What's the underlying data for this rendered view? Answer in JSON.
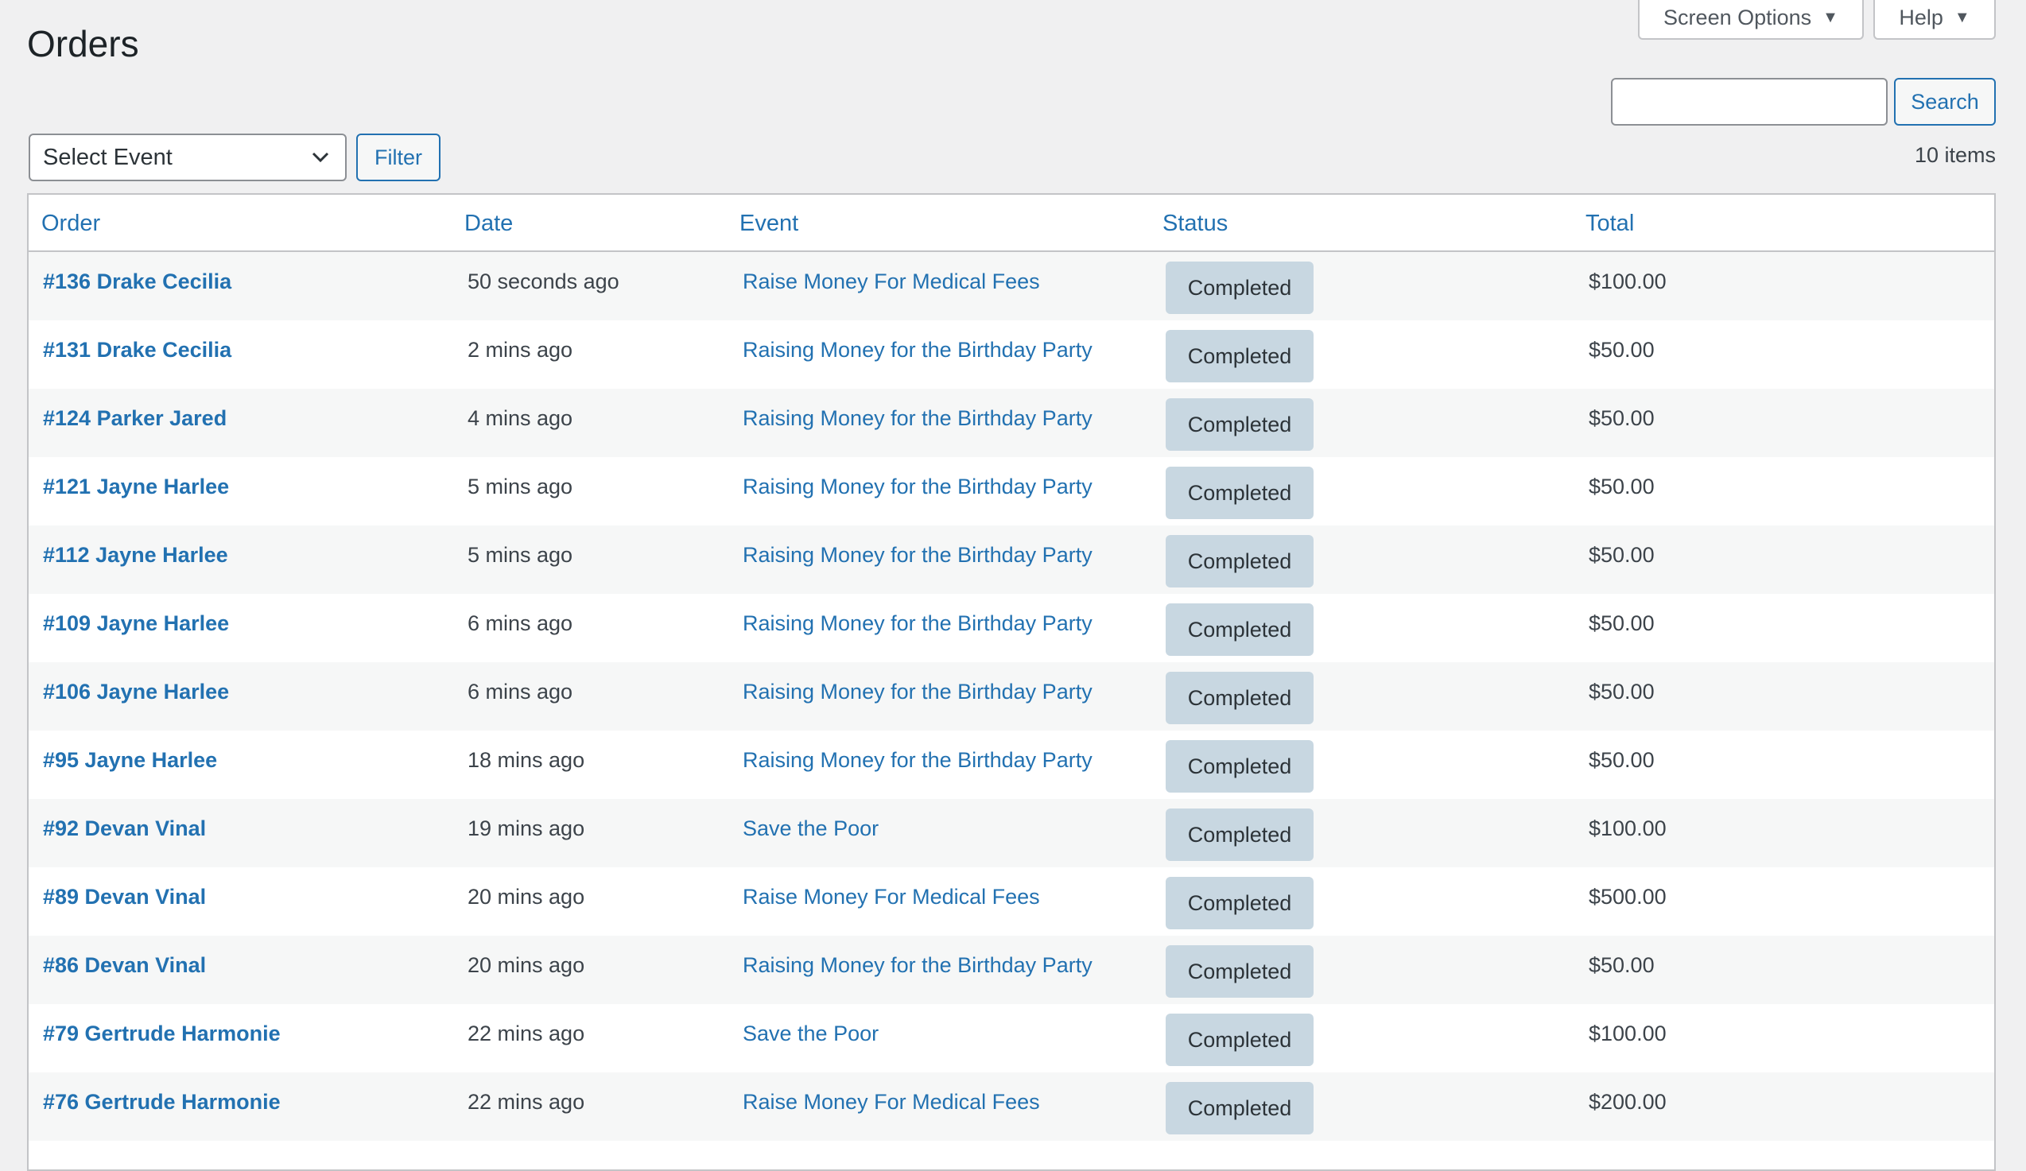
{
  "page": {
    "title": "Orders"
  },
  "screen_options": {
    "label": "Screen Options"
  },
  "help": {
    "label": "Help"
  },
  "search": {
    "button_label": "Search",
    "value": ""
  },
  "filter": {
    "select_value": "Select Event",
    "button_label": "Filter"
  },
  "items_count": "10 items",
  "table": {
    "columns": {
      "order": "Order",
      "date": "Date",
      "event": "Event",
      "status": "Status",
      "total": "Total"
    },
    "rows": [
      {
        "order": "#136 Drake Cecilia",
        "date": "50 seconds ago",
        "event": "Raise Money For Medical Fees",
        "status": "Completed",
        "total": "$100.00"
      },
      {
        "order": "#131 Drake Cecilia",
        "date": "2 mins ago",
        "event": "Raising Money for the Birthday Party",
        "status": "Completed",
        "total": "$50.00"
      },
      {
        "order": "#124 Parker Jared",
        "date": "4 mins ago",
        "event": "Raising Money for the Birthday Party",
        "status": "Completed",
        "total": "$50.00"
      },
      {
        "order": "#121 Jayne Harlee",
        "date": "5 mins ago",
        "event": "Raising Money for the Birthday Party",
        "status": "Completed",
        "total": "$50.00"
      },
      {
        "order": "#112 Jayne Harlee",
        "date": "5 mins ago",
        "event": "Raising Money for the Birthday Party",
        "status": "Completed",
        "total": "$50.00"
      },
      {
        "order": "#109 Jayne Harlee",
        "date": "6 mins ago",
        "event": "Raising Money for the Birthday Party",
        "status": "Completed",
        "total": "$50.00"
      },
      {
        "order": "#106 Jayne Harlee",
        "date": "6 mins ago",
        "event": "Raising Money for the Birthday Party",
        "status": "Completed",
        "total": "$50.00"
      },
      {
        "order": "#95 Jayne Harlee",
        "date": "18 mins ago",
        "event": "Raising Money for the Birthday Party",
        "status": "Completed",
        "total": "$50.00"
      },
      {
        "order": "#92 Devan Vinal",
        "date": "19 mins ago",
        "event": "Save the Poor",
        "status": "Completed",
        "total": "$100.00"
      },
      {
        "order": "#89 Devan Vinal",
        "date": "20 mins ago",
        "event": "Raise Money For Medical Fees",
        "status": "Completed",
        "total": "$500.00"
      },
      {
        "order": "#86 Devan Vinal",
        "date": "20 mins ago",
        "event": "Raising Money for the Birthday Party",
        "status": "Completed",
        "total": "$50.00"
      },
      {
        "order": "#79 Gertrude Harmonie",
        "date": "22 mins ago",
        "event": "Save the Poor",
        "status": "Completed",
        "total": "$100.00"
      },
      {
        "order": "#76 Gertrude Harmonie",
        "date": "22 mins ago",
        "event": "Raise Money For Medical Fees",
        "status": "Completed",
        "total": "$200.00"
      }
    ]
  },
  "icons": {
    "caret": "caret-down-icon",
    "select_chevron": "chevron-down-icon"
  }
}
